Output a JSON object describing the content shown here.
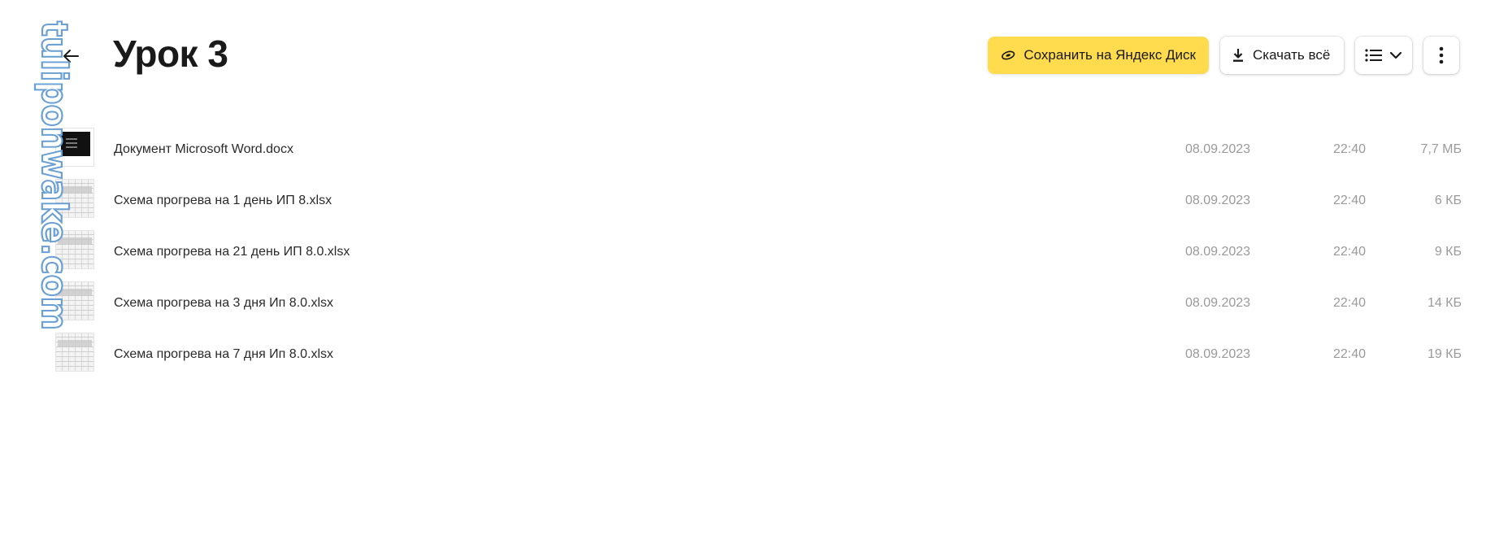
{
  "watermark": "tuliponwake.com",
  "page": {
    "title": "Урок 3",
    "back_icon": "arrow-left-icon"
  },
  "toolbar": {
    "save_label": "Сохранить на Яндекс Диск",
    "save_icon": "yandex-disk-icon",
    "save_color": "#ffdb4d",
    "download_label": "Скачать всё",
    "download_icon": "download-icon",
    "view_icon": "list-view-icon",
    "view_chevron_icon": "chevron-down-icon",
    "more_icon": "more-vertical-icon"
  },
  "files": [
    {
      "name": "Документ Microsoft Word.docx",
      "date": "08.09.2023",
      "time": "22:40",
      "size": "7,7 МБ",
      "thumb": "doc"
    },
    {
      "name": "Схема прогрева на 1 день ИП 8.xlsx",
      "date": "08.09.2023",
      "time": "22:40",
      "size": "6 КБ",
      "thumb": "sheet"
    },
    {
      "name": "Схема прогрева на 21 день ИП 8.0.xlsx",
      "date": "08.09.2023",
      "time": "22:40",
      "size": "9 КБ",
      "thumb": "sheet"
    },
    {
      "name": "Схема прогрева на 3 дня Ип 8.0.xlsx",
      "date": "08.09.2023",
      "time": "22:40",
      "size": "14 КБ",
      "thumb": "sheet"
    },
    {
      "name": "Схема прогрева на 7 дня Ип 8.0.xlsx",
      "date": "08.09.2023",
      "time": "22:40",
      "size": "19 КБ",
      "thumb": "sheet"
    }
  ]
}
